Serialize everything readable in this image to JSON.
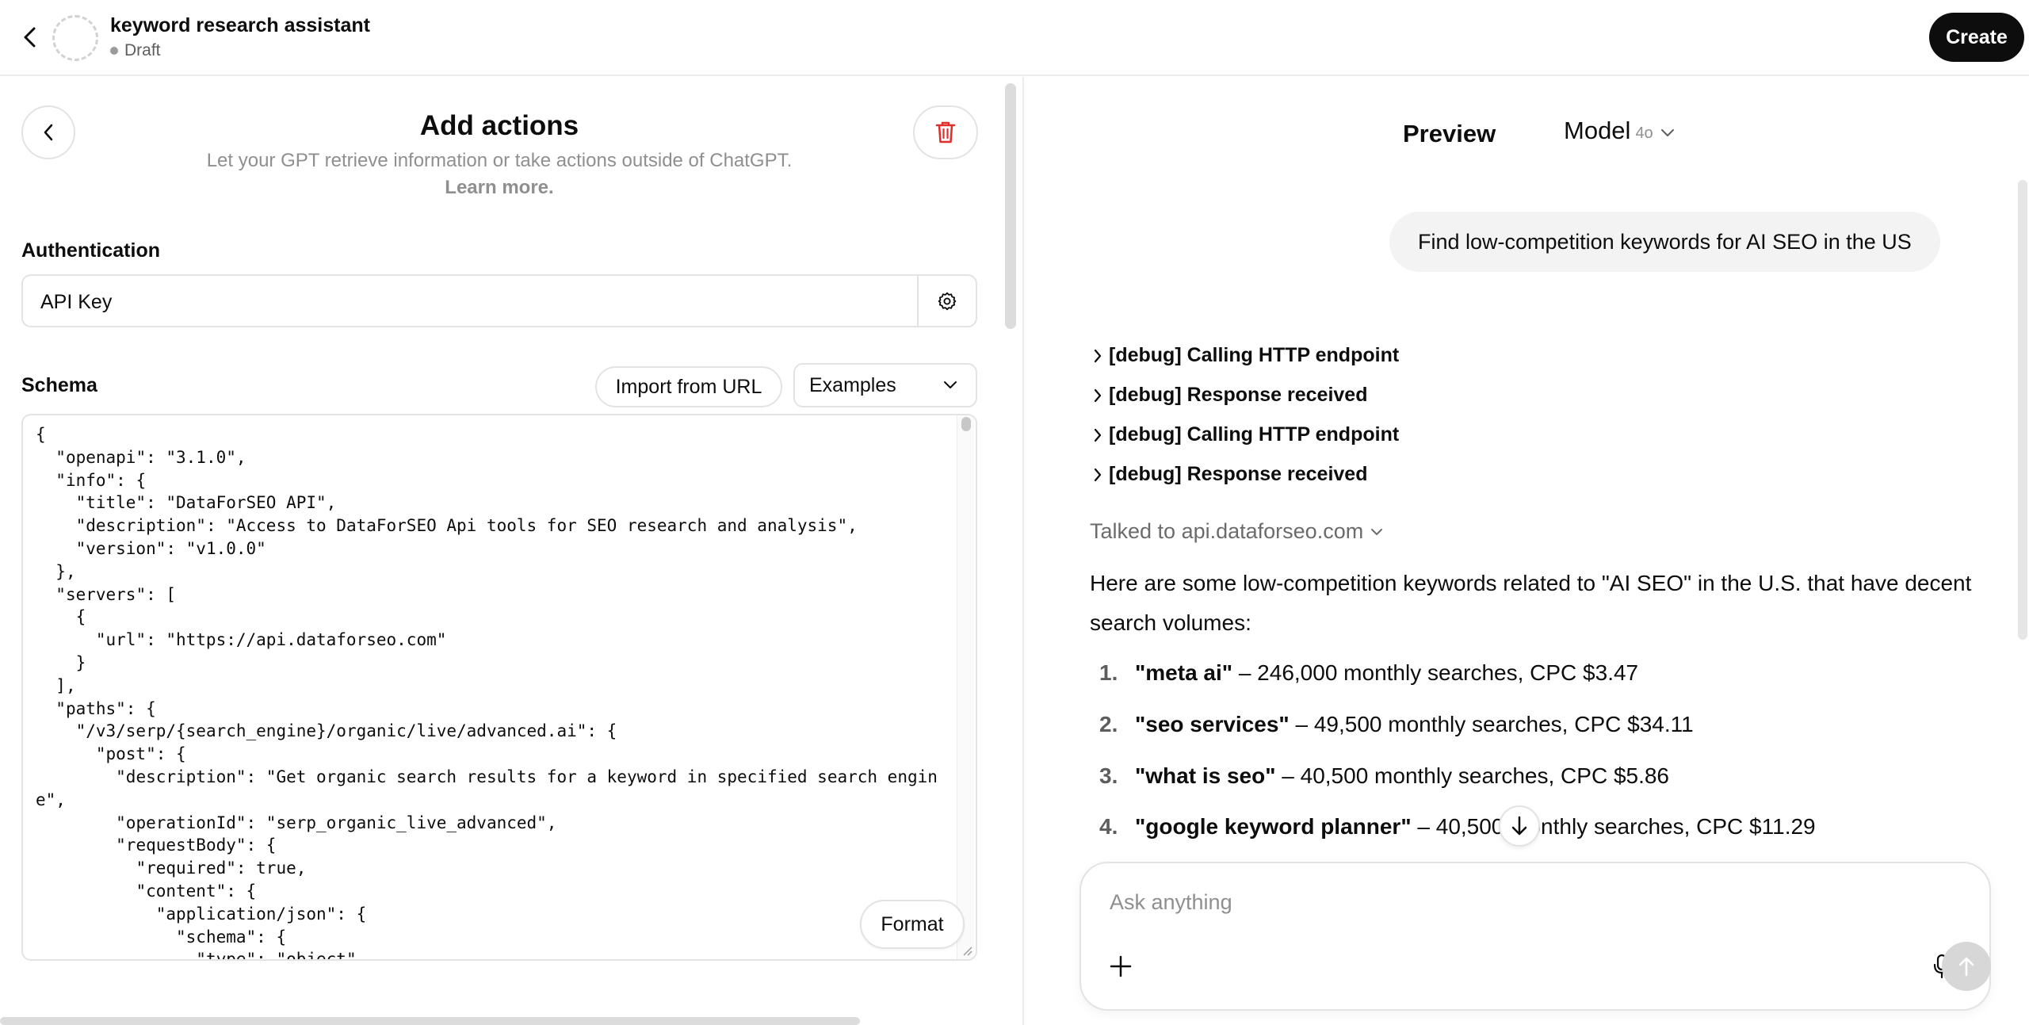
{
  "header": {
    "gpt_name": "keyword research assistant",
    "status": "Draft",
    "create_label": "Create"
  },
  "actions_panel": {
    "title": "Add actions",
    "description": "Let your GPT retrieve information or take actions outside of ChatGPT.",
    "learn_more": "Learn more.",
    "authentication": {
      "label": "Authentication",
      "value": "API Key"
    },
    "schema": {
      "label": "Schema",
      "import_label": "Import from URL",
      "examples_label": "Examples",
      "format_label": "Format",
      "code": "{\n  \"openapi\": \"3.1.0\",\n  \"info\": {\n    \"title\": \"DataForSEO API\",\n    \"description\": \"Access to DataForSEO Api tools for SEO research and analysis\",\n    \"version\": \"v1.0.0\"\n  },\n  \"servers\": [\n    {\n      \"url\": \"https://api.dataforseo.com\"\n    }\n  ],\n  \"paths\": {\n    \"/v3/serp/{search_engine}/organic/live/advanced.ai\": {\n      \"post\": {\n        \"description\": \"Get organic search results for a keyword in specified search engine\",\n        \"operationId\": \"serp_organic_live_advanced\",\n        \"requestBody\": {\n          \"required\": true,\n          \"content\": {\n            \"application/json\": {\n              \"schema\": {\n                \"type\": \"object\""
    }
  },
  "preview": {
    "title": "Preview",
    "model_label": "Model",
    "model_version": "4o",
    "user_message": "Find low-competition keywords for AI SEO in the US",
    "debug_lines": [
      "[debug] Calling HTTP endpoint",
      "[debug] Response received",
      "[debug] Calling HTTP endpoint",
      "[debug] Response received"
    ],
    "talked_to": "Talked to api.dataforseo.com",
    "assistant_intro": "Here are some low-competition keywords related to \"AI SEO\" in the U.S. that have decent search volumes:",
    "keywords": [
      {
        "num": "1.",
        "name": "\"meta ai\"",
        "detail": " – 246,000 monthly searches, CPC $3.47"
      },
      {
        "num": "2.",
        "name": "\"seo services\"",
        "detail": " – 49,500 monthly searches, CPC $34.11"
      },
      {
        "num": "3.",
        "name": "\"what is seo\"",
        "detail": " – 40,500 monthly searches, CPC $5.86"
      },
      {
        "num": "4.",
        "name": "\"google keyword planner\"",
        "detail": " – 40,500 monthly searches, CPC $11.29"
      }
    ],
    "composer_placeholder": "Ask anything"
  },
  "colors": {
    "accent_black": "#0d0d0d",
    "danger_red": "#e02e2a",
    "muted_text": "#8f8f8f",
    "bubble_bg": "#f3f3f3",
    "border": "#e3e3e3"
  },
  "icons": [
    "chevron-left-icon",
    "trash-icon",
    "gear-icon",
    "chevron-down-icon",
    "chevron-right-icon",
    "arrow-down-icon",
    "plus-icon",
    "mic-icon",
    "arrow-up-icon"
  ]
}
